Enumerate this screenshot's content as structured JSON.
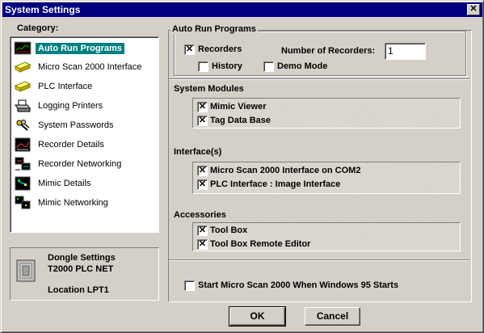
{
  "window": {
    "title": "System Settings",
    "close_glyph": "✕"
  },
  "category": {
    "label": "Category:",
    "items": [
      {
        "label": "Auto Run Programs",
        "icon": "monitor-icon",
        "selected": true
      },
      {
        "label": "Micro Scan 2000 Interface",
        "icon": "yellow-module-icon",
        "selected": false
      },
      {
        "label": "PLC Interface",
        "icon": "yellow-module-icon",
        "selected": false
      },
      {
        "label": "Logging Printers",
        "icon": "printer-icon",
        "selected": false
      },
      {
        "label": "System Passwords",
        "icon": "keys-icon",
        "selected": false
      },
      {
        "label": "Recorder Details",
        "icon": "recorder-icon",
        "selected": false
      },
      {
        "label": "Recorder Networking",
        "icon": "network-icon",
        "selected": false
      },
      {
        "label": "Mimic Details",
        "icon": "mimic-icon",
        "selected": false
      },
      {
        "label": "Mimic Networking",
        "icon": "mimic-network-icon",
        "selected": false
      }
    ]
  },
  "dongle": {
    "title": "Dongle Settings",
    "model": "T2000 PLC NET",
    "location": "Location LPT1"
  },
  "auto_run": {
    "legend": "Auto Run Programs",
    "recorders": {
      "label": "Recorders",
      "checked": true
    },
    "history": {
      "label": "History",
      "checked": false
    },
    "demo_mode": {
      "label": "Demo Mode",
      "checked": false
    },
    "num_recorders_label": "Number of Recorders:",
    "num_recorders_value": "1"
  },
  "system_modules": {
    "title": "System Modules",
    "items": [
      {
        "label": "Mimic Viewer",
        "checked": true
      },
      {
        "label": "Tag Data Base",
        "checked": true
      }
    ]
  },
  "interfaces": {
    "title": "Interface(s)",
    "items": [
      {
        "label": "Micro Scan 2000 Interface on COM2",
        "checked": true
      },
      {
        "label": "PLC Interface : Image Interface",
        "checked": true
      }
    ]
  },
  "accessories": {
    "title": "Accessories",
    "items": [
      {
        "label": "Tool Box",
        "checked": true
      },
      {
        "label": "Tool Box Remote Editor",
        "checked": true
      }
    ]
  },
  "startup": {
    "label": "Start Micro Scan 2000 When Windows 95 Starts",
    "checked": false
  },
  "buttons": {
    "ok": "OK",
    "cancel": "Cancel"
  },
  "check_glyph": "✕"
}
